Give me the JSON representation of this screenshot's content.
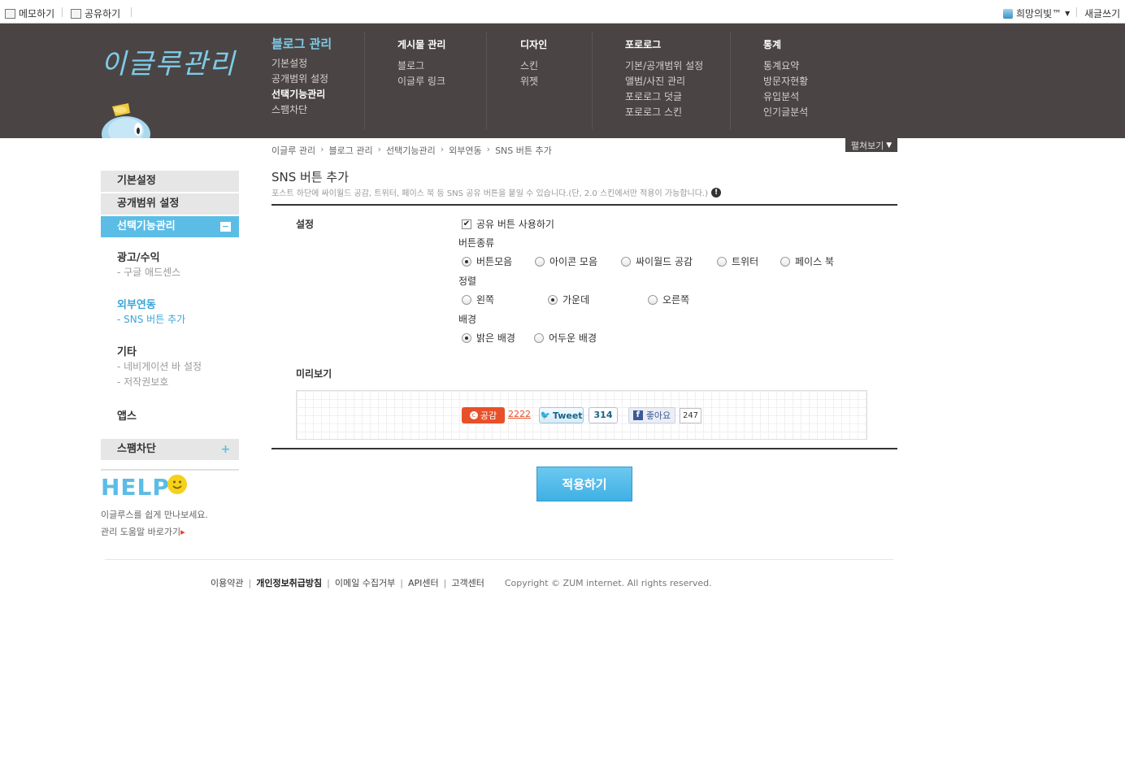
{
  "topbar": {
    "memo_label": "메모하기",
    "share_label": "공유하기",
    "user_label": "희망의빛™",
    "write_label": "새글쓰기"
  },
  "header": {
    "logo_text": "이글루관리",
    "menus": [
      {
        "title": "블로그 관리",
        "items": [
          "기본설정",
          "공개범위 설정",
          "선택기능관리",
          "스팸차단"
        ]
      },
      {
        "title": "게시물 관리",
        "items": [
          "블로그",
          "이글루 링크"
        ]
      },
      {
        "title": "디자인",
        "items": [
          "스킨",
          "위젯"
        ]
      },
      {
        "title": "포로로그",
        "items": [
          "기본/공개범위 설정",
          "앨범/사진 관리",
          "포로로그 덧글",
          "포로로그 스킨"
        ]
      },
      {
        "title": "통계",
        "items": [
          "통계요약",
          "방문자현황",
          "유입분석",
          "인기글분석"
        ]
      }
    ]
  },
  "breadcrumb": [
    "이글루 관리",
    "블로그 관리",
    "선택기능관리",
    "외부연동",
    "SNS 버튼 추가"
  ],
  "expand_label": "펼쳐보기",
  "sidebar": {
    "heads": [
      "기본설정",
      "공개범위 설정",
      "선택기능관리"
    ],
    "toggle_minus": "−",
    "groups": [
      {
        "title": "광고/수익",
        "items": [
          "- 구글 애드센스"
        ]
      },
      {
        "title": "외부연동",
        "items": [
          "- SNS 버튼 추가"
        ]
      },
      {
        "title": "기타",
        "items": [
          "- 네비게이션 바 설정",
          "- 저작권보호"
        ]
      },
      {
        "title": "앱스",
        "items": []
      }
    ],
    "spam_label": "스팸차단",
    "toggle_plus": "+"
  },
  "help": {
    "logo": "HELP",
    "line1": "이글루스를 쉽게 만나보세요.",
    "line2": "관리 도움말 바로가기",
    "arrow": "▸"
  },
  "content": {
    "title": "SNS 버튼 추가",
    "desc": "포스트 하단에 싸이월드 공감, 트위터, 페이스 북 등 SNS 공유 버튼을 붙일 수 있습니다.(단, 2.0 스킨에서만 적용이 가능합니다.)",
    "info_icon": "!",
    "setting_label": "설정",
    "use_share": "공유 버튼 사용하기",
    "check_mark": "✔",
    "type_label": "버튼종류",
    "type_options": [
      "버튼모음",
      "아이콘 모음",
      "싸이월드 공감",
      "트위터",
      "페이스 북"
    ],
    "align_label": "정렬",
    "align_options": [
      "왼쪽",
      "가운데",
      "오른쪽"
    ],
    "bg_label": "배경",
    "bg_options": [
      "밝은 배경",
      "어두운 배경"
    ],
    "preview_label": "미리보기",
    "preview": {
      "gonggam_dot": "c",
      "gonggam": "공감",
      "gonggam_count": "2222",
      "tweet_bird": "🐦",
      "tweet": "Tweet",
      "tweet_count": "314",
      "fb_f": "f",
      "like": "좋아요",
      "like_count": "247"
    },
    "apply": "적용하기"
  },
  "footer": {
    "links": [
      "이용약관",
      "개인정보취급방침",
      "이메일 수집거부",
      "API센터",
      "고객센터"
    ],
    "copyright": "Copyright © ZUM internet. All rights reserved."
  }
}
